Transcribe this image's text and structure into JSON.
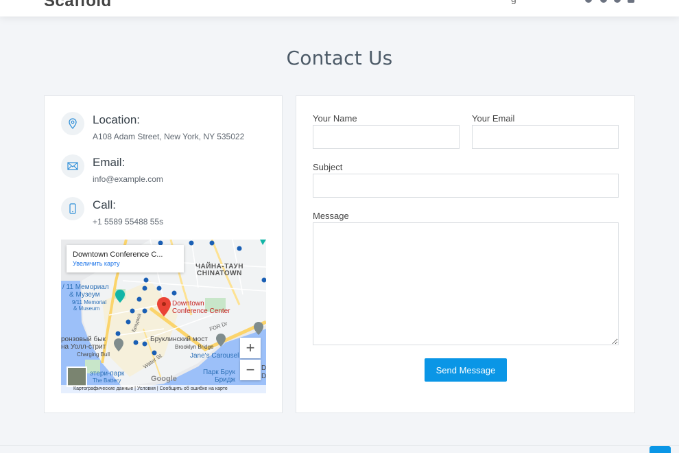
{
  "header": {
    "brand": "Scaffold",
    "nav_fragment": "g"
  },
  "section": {
    "title": "Contact Us"
  },
  "info": {
    "items": [
      {
        "title": "Location:",
        "text": "A108 Adam Street, New York, NY 535022",
        "icon": "map-pin-icon"
      },
      {
        "title": "Email:",
        "text": "info@example.com",
        "icon": "envelope-icon"
      },
      {
        "title": "Call:",
        "text": "+1 5589 55488 55s",
        "icon": "phone-icon"
      }
    ]
  },
  "map": {
    "popup_title": "Downtown Conference C...",
    "popup_link": "Увеличить карту",
    "labels": {
      "chinatown_ru": "ЧАЙНА-ТАУН",
      "chinatown_en": "CHINATOWN",
      "memorial_1": "/ 11 Мемориал",
      "memorial_2": "& Музеум",
      "memorial_3": "9/11 Memorial",
      "memorial_4": "& Museum",
      "pin_1": "Downtown",
      "pin_2": "Conference Center",
      "bull_1": "ронзовый бык",
      "bull_2": "на Уолл-стрит",
      "bull_3": "Charging Bull",
      "bridge_ru": "Бруклинский мост",
      "bridge_en": "Brooklyn Bridge",
      "carousel": "Jane's Carousel",
      "fdr": "FDR Dr",
      "water": "Water St",
      "broadway": "Бродвей",
      "battery_1": "этери-парк",
      "battery_2": "The Battery",
      "park_1": "Парк Брук",
      "park_2": "Бридж",
      "google": "Google",
      "d1": "D",
      "d2": "D"
    },
    "zoom_in": "+",
    "zoom_out": "−",
    "footer": "Картографические данные  |  Условия  |  Сообщить об ошибке на карте"
  },
  "form": {
    "name_label": "Your Name",
    "email_label": "Your Email",
    "subject_label": "Subject",
    "message_label": "Message",
    "name_value": "",
    "email_value": "",
    "subject_value": "",
    "message_value": "",
    "submit": "Send Message"
  },
  "colors": {
    "accent": "#0a96e6",
    "title": "#4d5b68",
    "background": "#f3f5f8"
  }
}
